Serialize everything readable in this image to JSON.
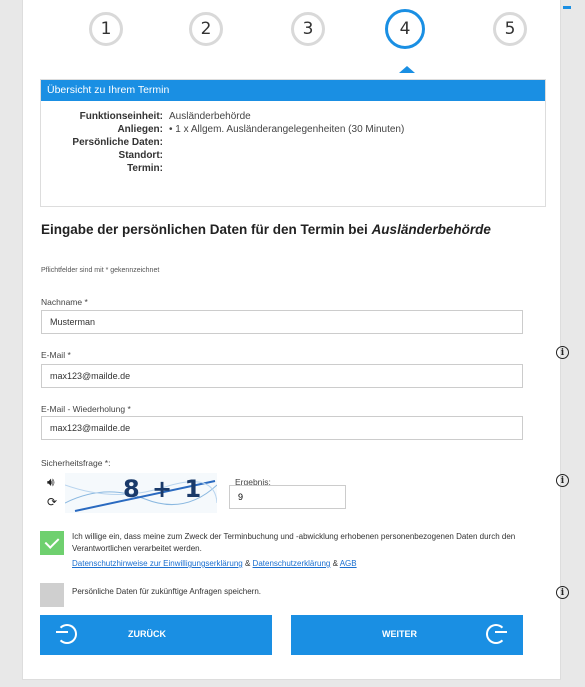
{
  "steps": [
    {
      "number": "1",
      "active": false
    },
    {
      "number": "2",
      "active": false
    },
    {
      "number": "3",
      "active": false
    },
    {
      "number": "4",
      "active": true
    },
    {
      "number": "5",
      "active": false
    }
  ],
  "summary": {
    "header": "Übersicht zu Ihrem Termin",
    "rows": [
      {
        "label": "Funktionseinheit:",
        "value": "Ausländerbehörde"
      },
      {
        "label": "Anliegen:",
        "value": "• 1 x Allgem. Ausländerangelegenheiten (30 Minuten)"
      },
      {
        "label": "Persönliche Daten:",
        "value": ""
      },
      {
        "label": "Standort:",
        "value": ""
      },
      {
        "label": "Termin:",
        "value": ""
      }
    ]
  },
  "form": {
    "heading_prefix": "Eingabe der persönlichen Daten für den Termin bei ",
    "heading_authority": "Ausländerbehörde",
    "required_hint": "Pflichtfelder sind mit * gekennzeichnet",
    "nachname_label": "Nachname *",
    "nachname_value": "Musterman",
    "email_label": "E-Mail *",
    "email_value": "max123@mailde.de",
    "email_repeat_label": "E-Mail - Wiederholung *",
    "email_repeat_value": "max123@mailde.de",
    "security_label": "Sicherheitsfrage *:",
    "captcha_text": "8 + 1",
    "result_label": "Ergebnis:",
    "result_value": "9",
    "consent_text": "Ich willige ein, dass meine zum Zweck der Terminbuchung und -abwicklung erhobenen personenbezogenen Daten durch den Verantwortlichen verarbeitet werden.",
    "consent_checked": true,
    "link_consent": "Datenschutzhinweise zur Einwilligungserklärung",
    "link_sep1": " & ",
    "link_privacy": "Datenschutzerklärung",
    "link_sep2": " & ",
    "link_agb": "AGB",
    "save_label": "Persönliche Daten für zukünftige Anfragen speichern.",
    "save_checked": false
  },
  "buttons": {
    "back": "ZURÜCK",
    "next": "WEITER"
  },
  "icons": {
    "info": "i",
    "audio": "🔊︎",
    "reload": "⟳"
  },
  "colors": {
    "accent": "#1a8fe3",
    "check_on": "#6fd06f",
    "check_off": "#cfcfcf"
  }
}
